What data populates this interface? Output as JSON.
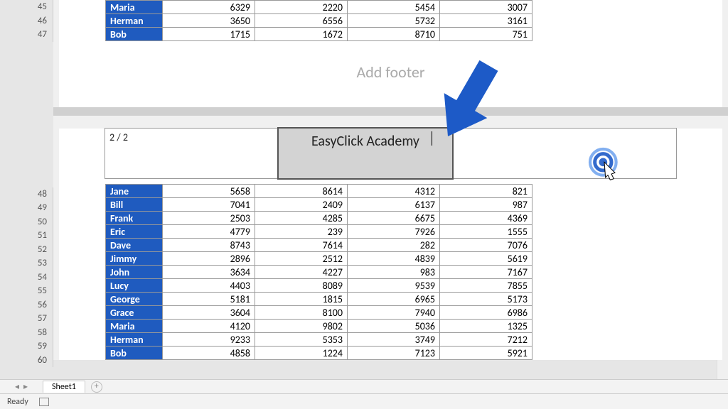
{
  "rows_top": [
    45,
    46,
    47
  ],
  "rows_bottom": [
    48,
    49,
    50,
    51,
    52,
    53,
    54,
    55,
    56,
    57,
    58,
    59,
    60
  ],
  "table_top": [
    {
      "name": "Maria",
      "v": [
        6329,
        2220,
        5454,
        3007
      ]
    },
    {
      "name": "Herman",
      "v": [
        3650,
        6556,
        5732,
        3161
      ]
    },
    {
      "name": "Bob",
      "v": [
        1715,
        1672,
        8710,
        751
      ]
    }
  ],
  "table_bottom": [
    {
      "name": "Jane",
      "v": [
        5658,
        8614,
        4312,
        821
      ]
    },
    {
      "name": "Bill",
      "v": [
        7041,
        2409,
        6137,
        987
      ]
    },
    {
      "name": "Frank",
      "v": [
        2503,
        4285,
        6675,
        4369
      ]
    },
    {
      "name": "Eric",
      "v": [
        4779,
        239,
        7926,
        1555
      ]
    },
    {
      "name": "Dave",
      "v": [
        8743,
        7614,
        282,
        7076
      ]
    },
    {
      "name": "Jimmy",
      "v": [
        2896,
        2512,
        4839,
        5619
      ]
    },
    {
      "name": "John",
      "v": [
        3634,
        4227,
        983,
        7167
      ]
    },
    {
      "name": "Lucy",
      "v": [
        4403,
        8089,
        9539,
        7855
      ]
    },
    {
      "name": "George",
      "v": [
        5181,
        1815,
        6965,
        5173
      ]
    },
    {
      "name": "Grace",
      "v": [
        3604,
        8100,
        7940,
        6986
      ]
    },
    {
      "name": "Maria",
      "v": [
        4120,
        9802,
        5036,
        1325
      ]
    },
    {
      "name": "Herman",
      "v": [
        9233,
        5353,
        3749,
        7212
      ]
    },
    {
      "name": "Bob",
      "v": [
        4858,
        1224,
        7123,
        5921
      ]
    }
  ],
  "footer_placeholder": "Add footer",
  "header": {
    "left": "2 / 2",
    "center": "EasyClick Academy"
  },
  "sheet_tab": "Sheet1",
  "status": "Ready",
  "colors": {
    "name_bg": "#1f5bbf",
    "arrow": "#1d5ac7"
  }
}
